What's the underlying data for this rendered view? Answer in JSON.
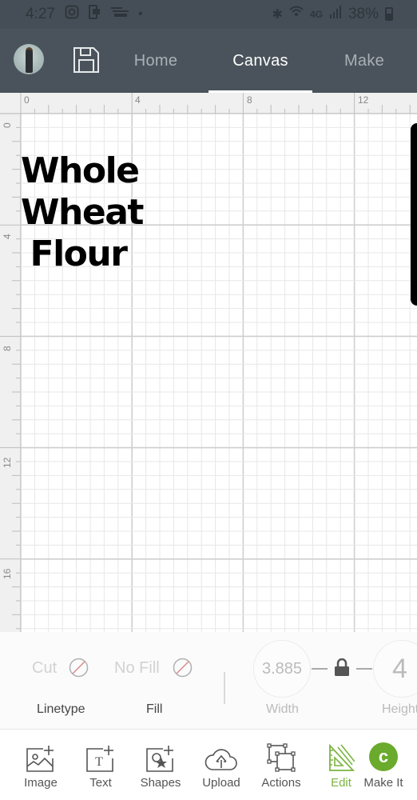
{
  "status_bar": {
    "time": "4:27",
    "left_icons": [
      "instagram-icon",
      "cast-icon",
      "weather-icon",
      "dot-icon"
    ],
    "right_icons": [
      "bluetooth-icon",
      "wifi-icon",
      "4g-lte-icon",
      "signal-icon"
    ],
    "battery": "38%"
  },
  "header": {
    "avatar_alt": "User avatar",
    "save_icon": "save-icon",
    "tabs": [
      {
        "label": "Home",
        "active": false
      },
      {
        "label": "Canvas",
        "active": true
      },
      {
        "label": "Make",
        "active": false
      }
    ]
  },
  "canvas": {
    "ruler_top_labels": [
      "0",
      "4",
      "8",
      "12"
    ],
    "ruler_left_labels": [
      "0",
      "4",
      "8",
      "12",
      "16"
    ],
    "design_text": [
      "Whole",
      "Wheat",
      "Flour"
    ]
  },
  "properties": {
    "linetype_value": "Cut",
    "linetype_label": "Linetype",
    "fill_value": "No Fill",
    "fill_label": "Fill",
    "width_value": "3.885",
    "width_label": "Width",
    "height_value": "4",
    "height_label": "Height",
    "lock_icon": "lock-icon"
  },
  "toolbar": {
    "items": [
      {
        "label": "Image",
        "icon": "image-add-icon"
      },
      {
        "label": "Text",
        "icon": "text-add-icon"
      },
      {
        "label": "Shapes",
        "icon": "shapes-add-icon"
      },
      {
        "label": "Upload",
        "icon": "upload-cloud-icon"
      },
      {
        "label": "Actions",
        "icon": "actions-icon"
      },
      {
        "label": "Edit",
        "icon": "edit-ruler-icon",
        "active": true
      },
      {
        "label": "Make It",
        "icon": "make-it-icon"
      }
    ],
    "accent": "#7cb342",
    "make_it_color": "#6aaa2c"
  }
}
